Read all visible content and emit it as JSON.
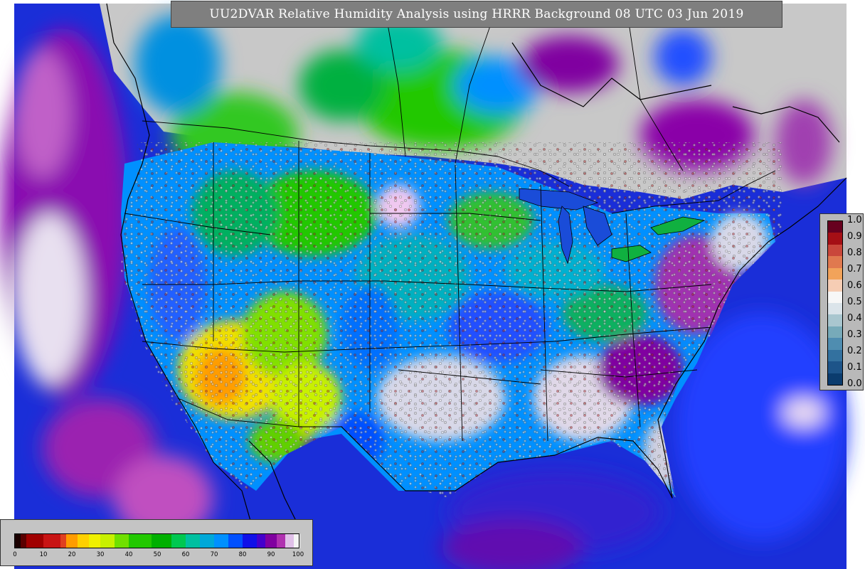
{
  "title": "UU2DVAR Relative Humidity Analysis using HRRR Background 08 UTC 03 Jun 2019",
  "station_legend": {
    "labels": [
      "1.0",
      "0.9",
      "0.8",
      "0.7",
      "0.6",
      "0.5",
      "0.4",
      "0.3",
      "0.2",
      "0.1",
      "0.0"
    ],
    "colors": [
      "#67001f",
      "#a50f15",
      "#c9473b",
      "#e0794f",
      "#f2a35a",
      "#f6cdb4",
      "#f7f7f7",
      "#dbe4ea",
      "#a9c6cf",
      "#77aab9",
      "#4f8db0",
      "#33719f",
      "#1d5489",
      "#0b3c6e"
    ]
  },
  "colorbar": {
    "tick_labels": [
      "0",
      "10",
      "20",
      "30",
      "40",
      "50",
      "60",
      "70",
      "80",
      "90",
      "100"
    ],
    "segments": [
      {
        "from": 0,
        "to": 2,
        "color": "#1a0000"
      },
      {
        "from": 2,
        "to": 4,
        "color": "#5a0000"
      },
      {
        "from": 4,
        "to": 10,
        "color": "#a00000"
      },
      {
        "from": 10,
        "to": 16,
        "color": "#c81414"
      },
      {
        "from": 16,
        "to": 18,
        "color": "#e04020"
      },
      {
        "from": 18,
        "to": 22,
        "color": "#ff9c00"
      },
      {
        "from": 22,
        "to": 26,
        "color": "#ffd000"
      },
      {
        "from": 26,
        "to": 30,
        "color": "#f0f000"
      },
      {
        "from": 30,
        "to": 35,
        "color": "#c8f000"
      },
      {
        "from": 35,
        "to": 40,
        "color": "#70e000"
      },
      {
        "from": 40,
        "to": 48,
        "color": "#22c800"
      },
      {
        "from": 48,
        "to": 55,
        "color": "#00b000"
      },
      {
        "from": 55,
        "to": 60,
        "color": "#00c850"
      },
      {
        "from": 60,
        "to": 65,
        "color": "#00c0a0"
      },
      {
        "from": 65,
        "to": 70,
        "color": "#00a8d8"
      },
      {
        "from": 70,
        "to": 75,
        "color": "#0090ff"
      },
      {
        "from": 75,
        "to": 80,
        "color": "#0050ff"
      },
      {
        "from": 80,
        "to": 85,
        "color": "#1010e8"
      },
      {
        "from": 85,
        "to": 88,
        "color": "#4400cc"
      },
      {
        "from": 88,
        "to": 92,
        "color": "#8000a0"
      },
      {
        "from": 92,
        "to": 95,
        "color": "#b030b0"
      },
      {
        "from": 95,
        "to": 98,
        "color": "#e0c0e8"
      },
      {
        "from": 98,
        "to": 100,
        "color": "#f4f4f4"
      }
    ]
  },
  "colors": {
    "ocean": "#1a2ed8",
    "land_high_rh": "#cfcfcf",
    "dry": "#f5d000",
    "very_dry": "#ff9c00",
    "moist": "#00b060",
    "humid": "#0090ff",
    "saturated": "#8000a0"
  }
}
